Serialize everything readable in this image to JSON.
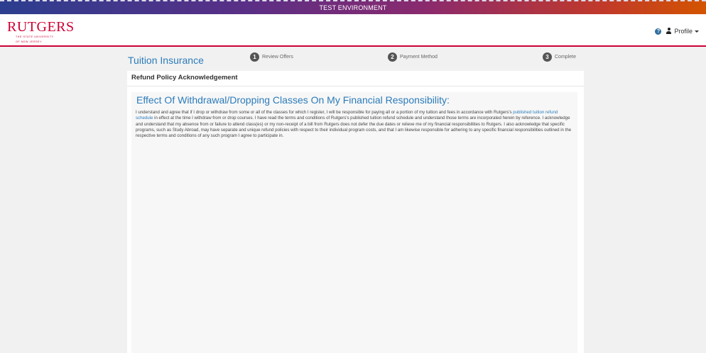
{
  "environment_banner": "TEST ENVIRONMENT",
  "brand": {
    "name": "RUTGERS",
    "tagline_line1": "THE STATE UNIVERSITY",
    "tagline_line2": "OF NEW JERSEY",
    "color": "#cc0033"
  },
  "header": {
    "help_icon": "question-circle-icon",
    "profile_label": "Profile"
  },
  "page": {
    "title": "Tuition Insurance"
  },
  "steps": [
    {
      "number": "1",
      "label": "Review Offers"
    },
    {
      "number": "2",
      "label": "Payment Method"
    },
    {
      "number": "3",
      "label": "Complete"
    }
  ],
  "card": {
    "heading": "Refund Policy Acknowledgement"
  },
  "policy": {
    "title": "Effect Of Withdrawal/Dropping Classes On My Financial Responsibility:",
    "text_before_link": "I understand and agree that if I drop or withdraw from some or all of the classes for which I register, I will be responsible for paying all or a portion of my tuition and fees in accordance with Rutgers's ",
    "link_text": "published tuition refund schedule",
    "text_after_link": " in effect at the time I withdraw from or drop courses. I have read the terms and conditions of Rutgers's published tuition refund schedule and understand those terms are incorporated herein by reference. I acknowledge and understand that my absence from or failure to attend class(es) or my non-receipt of a bill from Rutgers does not defer the due dates or relieve me of my financial responsibilities to Rutgers. I also acknowledge that specific programs, such as Study Abroad, may have separate and unique refund policies with respect to their individual program costs, and that I am likewise responsible for adhering to any specific financial responsibilities outlined in the respective terms and conditions of any such program I agree to participate in."
  },
  "colors": {
    "accent_blue": "#2b7bb9",
    "step_gray": "#555555"
  }
}
